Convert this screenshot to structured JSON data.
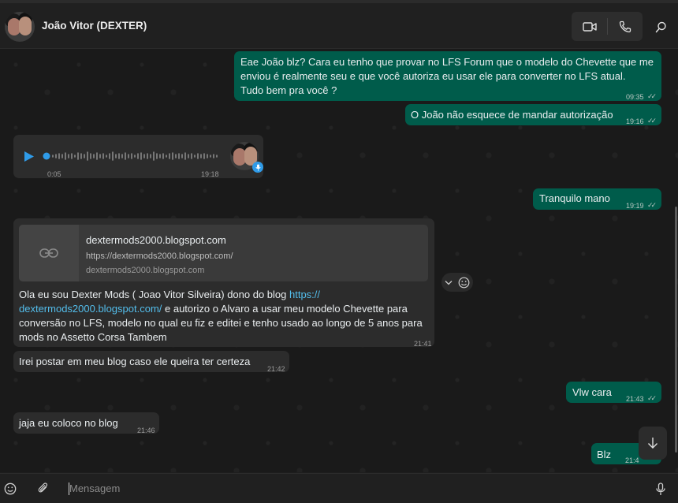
{
  "header": {
    "contact_name": "João Vitor (DEXTER)",
    "icons": [
      "avatar",
      "video-call-icon",
      "voice-call-icon",
      "search-icon"
    ]
  },
  "messages": [
    {
      "direction": "out",
      "lines": [
        "Eae João blz? Cara eu tenho que provar no LFS Forum que o modelo do Chevette que me",
        "enviou é realmente seu e que você autoriza eu usar ele para converter no LFS atual.",
        "Tudo bem pra você ?"
      ],
      "time": "09:35"
    },
    {
      "direction": "out",
      "text": "O João não esquece de mandar autorização",
      "time": "19:16"
    },
    {
      "direction": "in",
      "type": "voice",
      "duration": "0:05",
      "time": "19:18"
    },
    {
      "direction": "out",
      "text": "Tranquilo mano",
      "time": "19:19"
    },
    {
      "direction": "in",
      "type": "link",
      "link_title": "dextermods2000.blogspot.com",
      "link_url": "https://dextermods2000.blogspot.com/",
      "link_domain": "dextermods2000.blogspot.com",
      "line1_pre": "Ola eu sou Dexter Mods ( Joao Vitor Silveira) dono do blog ",
      "line1_link": "https://",
      "line2_link": "dextermods2000.blogspot.com/",
      "line2_post": " e autorizo o Alvaro a usar meu modelo Chevette para",
      "line3": "conversão no LFS, modelo no qual eu fiz e editei e tenho usado ao longo de 5 anos para",
      "line4": "mods no Assetto Corsa Tambem",
      "time": "21:41"
    },
    {
      "direction": "in",
      "text": "Irei postar em meu blog caso ele queira ter certeza",
      "time": "21:42"
    },
    {
      "direction": "out",
      "text": "Vlw cara",
      "time": "21:43"
    },
    {
      "direction": "in",
      "text": "jaja eu coloco no blog",
      "time": "21:46"
    },
    {
      "direction": "out",
      "text": "Blz",
      "time": "21:4"
    }
  ],
  "footer": {
    "placeholder": "Mensagem",
    "icons": [
      "emoji-icon",
      "attach-icon",
      "mic-icon"
    ]
  },
  "colors": {
    "outgoing": "#005c4b",
    "incoming": "#2c2c2c",
    "link": "#53bdeb",
    "voice_accent": "#2f9be8"
  }
}
